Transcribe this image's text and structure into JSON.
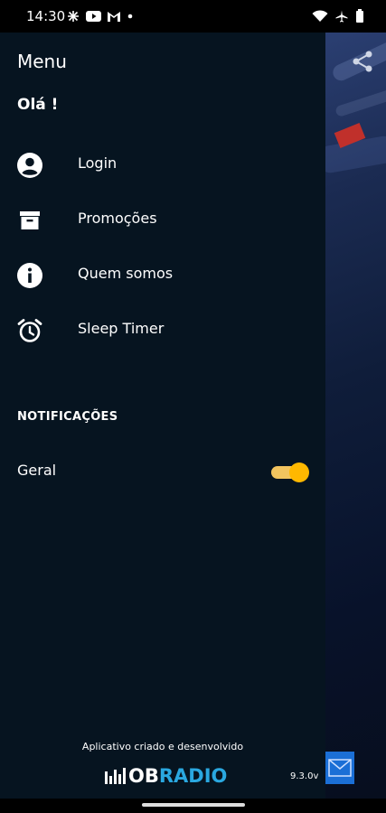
{
  "status_bar": {
    "time": "14:30",
    "left_icons": [
      "pinwheel-icon",
      "youtube-icon",
      "gmail-icon",
      "dot-icon"
    ],
    "right_icons": [
      "wifi-icon",
      "airplane-mode-icon",
      "battery-icon"
    ]
  },
  "drawer": {
    "title": "Menu",
    "greeting": "Olá !",
    "items": [
      {
        "label": "Login",
        "icon": "account-circle-icon"
      },
      {
        "label": "Promoções",
        "icon": "archive-box-icon"
      },
      {
        "label": "Quem somos",
        "icon": "info-icon"
      },
      {
        "label": "Sleep Timer",
        "icon": "alarm-clock-icon"
      }
    ],
    "notifications": {
      "section_title": "NOTIFICAÇÕES",
      "general_label": "Geral",
      "general_enabled": true
    },
    "footer": {
      "credit": "Aplicativo criado e desenvolvido",
      "logo_text_white": "OB",
      "logo_text_blue": "RADIO",
      "version": "9.3.0v"
    }
  },
  "background_app": {
    "icons": [
      "share-icon",
      "mail-icon"
    ]
  },
  "colors": {
    "drawer_bg": "#061420",
    "toggle_accent": "#ffb800",
    "logo_blue": "#2aa8e0",
    "mail_blue": "#1b6fd6"
  }
}
